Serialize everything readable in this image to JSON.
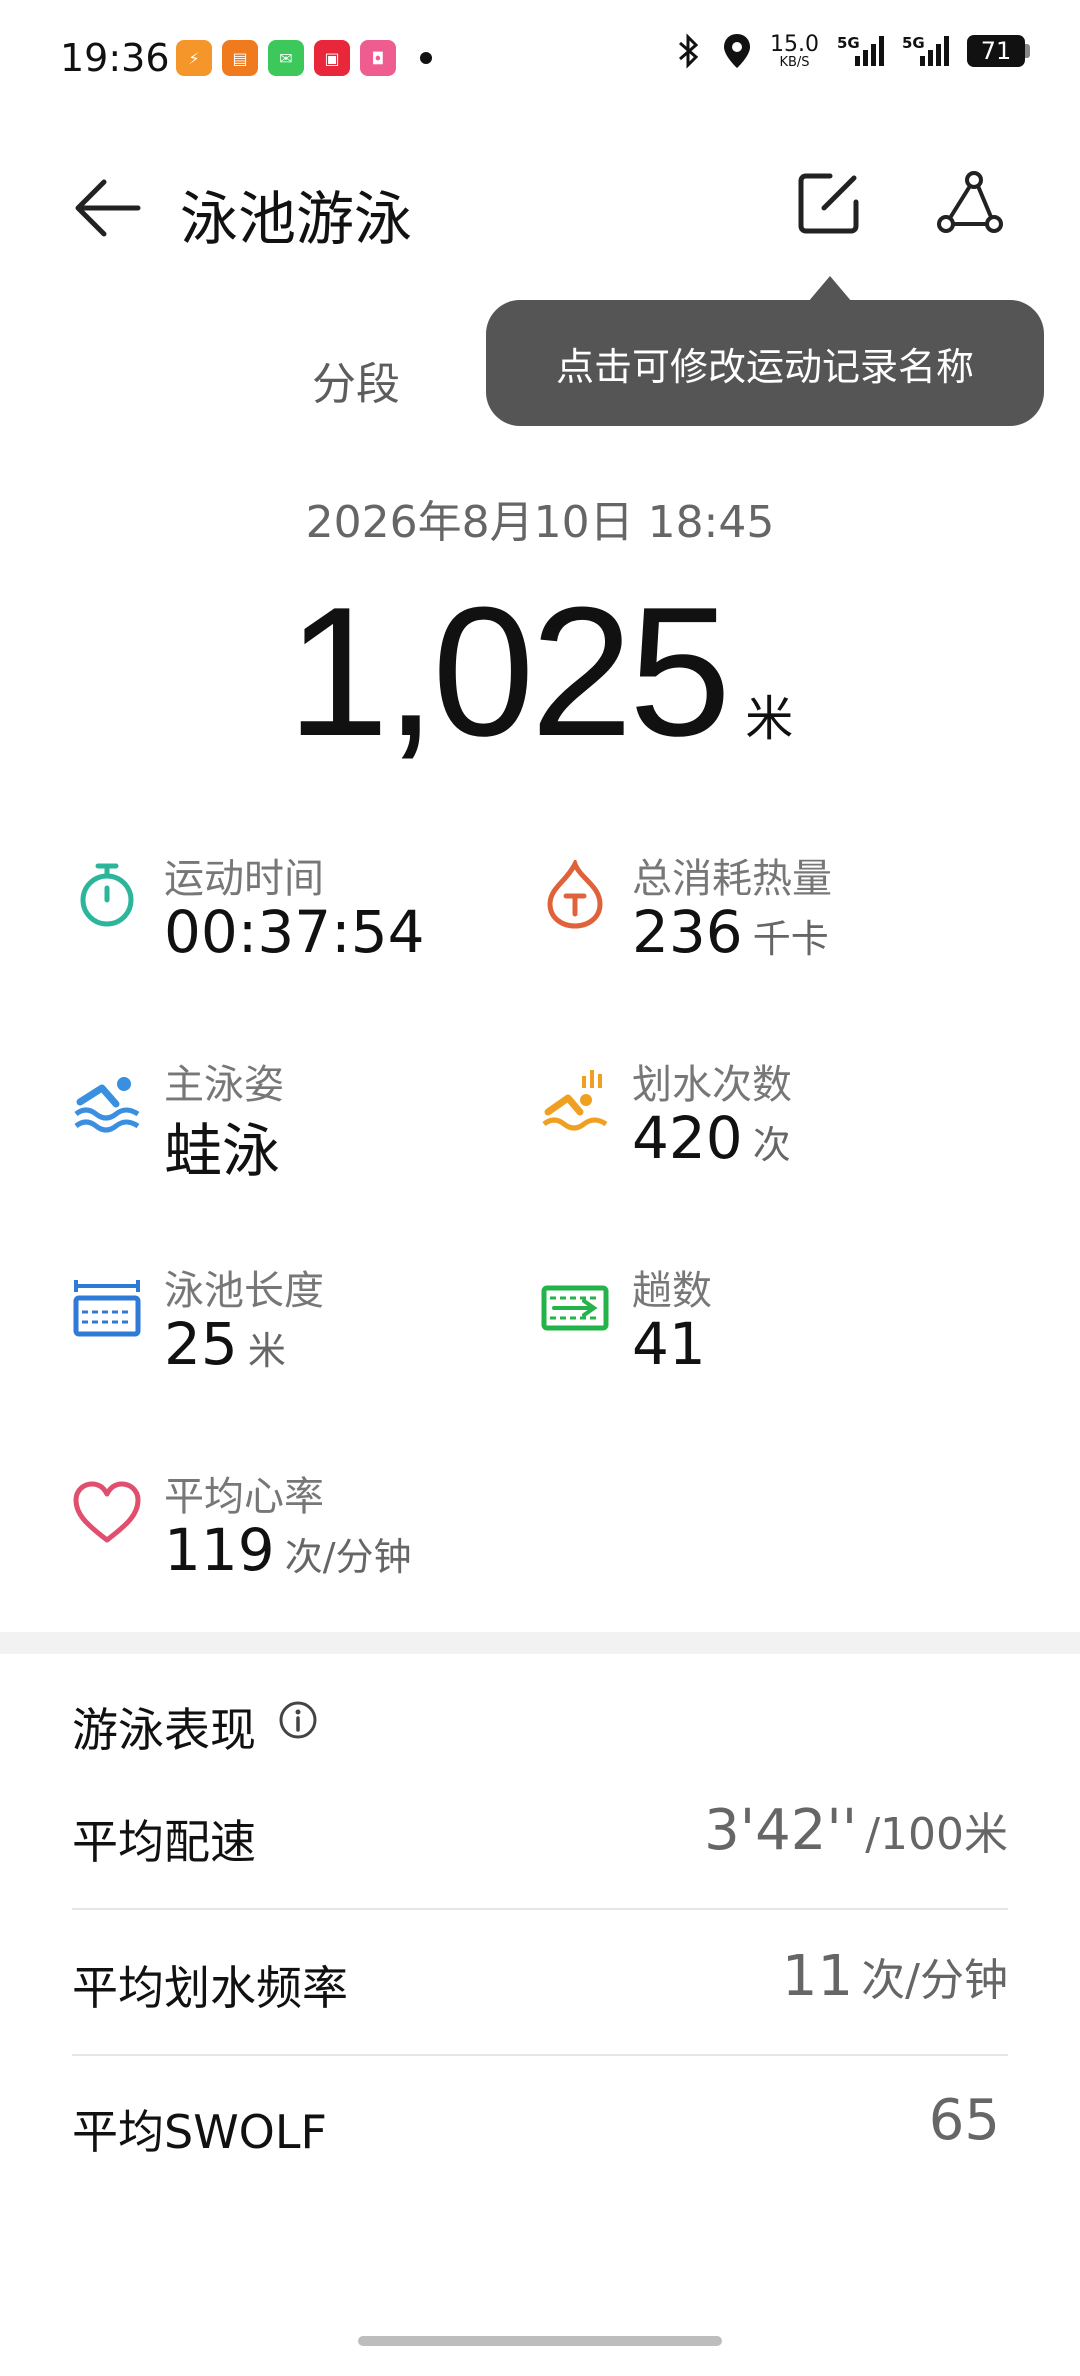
{
  "status_bar": {
    "time": "19:36",
    "net_speed": "15.0",
    "net_unit": "KB/S",
    "signal_1": "5G",
    "signal_2": "5G",
    "battery": "71"
  },
  "header": {
    "title": "泳池游泳",
    "icons": {
      "back": "back-arrow-icon",
      "edit": "edit-icon",
      "share": "route-share-icon"
    }
  },
  "tabs": {
    "segment": "分段"
  },
  "tooltip": "点击可修改运动记录名称",
  "record": {
    "date": "2026年8月10日 18:45",
    "distance": "1,025",
    "distance_unit": "米"
  },
  "stats": {
    "duration": {
      "label": "运动时间",
      "value": "00:37:54",
      "icon": "stopwatch-icon",
      "color": "#2bb59a"
    },
    "calories": {
      "label": "总消耗热量",
      "value": "236",
      "unit": "千卡",
      "icon": "calorie-flame-icon",
      "color": "#e0623b"
    },
    "stroke": {
      "label": "主泳姿",
      "value": "蛙泳",
      "icon": "swimmer-icon",
      "color": "#3a8fe0"
    },
    "stroke_count": {
      "label": "划水次数",
      "value": "420",
      "unit": "次",
      "icon": "swim-stroke-count-icon",
      "color": "#f0a020"
    },
    "pool_length": {
      "label": "泳池长度",
      "value": "25",
      "unit": "米",
      "icon": "pool-length-icon",
      "color": "#2f7ad6"
    },
    "laps": {
      "label": "趟数",
      "value": "41",
      "icon": "laps-icon",
      "color": "#23b34a"
    },
    "heart_rate": {
      "label": "平均心率",
      "value": "119",
      "unit": "次/分钟",
      "icon": "heart-icon",
      "color": "#e0506e"
    }
  },
  "performance": {
    "title": "游泳表现",
    "rows": [
      {
        "label": "平均配速",
        "value": "3'42''",
        "unit": "/100米"
      },
      {
        "label": "平均划水频率",
        "value": "11",
        "unit": "次/分钟"
      },
      {
        "label": "平均SWOLF",
        "value": "65",
        "unit": ""
      }
    ]
  }
}
